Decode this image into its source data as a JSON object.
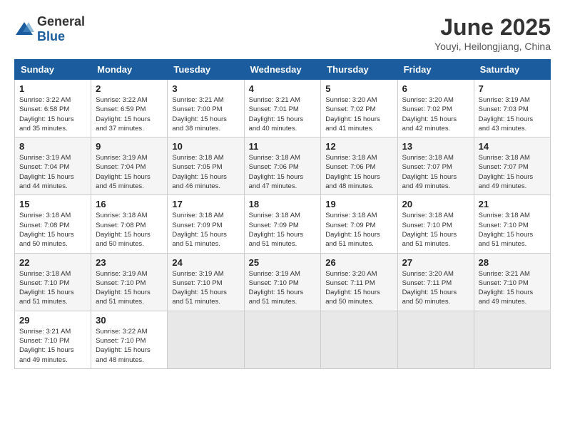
{
  "logo": {
    "general": "General",
    "blue": "Blue"
  },
  "header": {
    "month": "June 2025",
    "location": "Youyi, Heilongjiang, China"
  },
  "weekdays": [
    "Sunday",
    "Monday",
    "Tuesday",
    "Wednesday",
    "Thursday",
    "Friday",
    "Saturday"
  ],
  "weeks": [
    [
      {
        "day": "1",
        "info": "Sunrise: 3:22 AM\nSunset: 6:58 PM\nDaylight: 15 hours\nand 35 minutes."
      },
      {
        "day": "2",
        "info": "Sunrise: 3:22 AM\nSunset: 6:59 PM\nDaylight: 15 hours\nand 37 minutes."
      },
      {
        "day": "3",
        "info": "Sunrise: 3:21 AM\nSunset: 7:00 PM\nDaylight: 15 hours\nand 38 minutes."
      },
      {
        "day": "4",
        "info": "Sunrise: 3:21 AM\nSunset: 7:01 PM\nDaylight: 15 hours\nand 40 minutes."
      },
      {
        "day": "5",
        "info": "Sunrise: 3:20 AM\nSunset: 7:02 PM\nDaylight: 15 hours\nand 41 minutes."
      },
      {
        "day": "6",
        "info": "Sunrise: 3:20 AM\nSunset: 7:02 PM\nDaylight: 15 hours\nand 42 minutes."
      },
      {
        "day": "7",
        "info": "Sunrise: 3:19 AM\nSunset: 7:03 PM\nDaylight: 15 hours\nand 43 minutes."
      }
    ],
    [
      {
        "day": "8",
        "info": "Sunrise: 3:19 AM\nSunset: 7:04 PM\nDaylight: 15 hours\nand 44 minutes."
      },
      {
        "day": "9",
        "info": "Sunrise: 3:19 AM\nSunset: 7:04 PM\nDaylight: 15 hours\nand 45 minutes."
      },
      {
        "day": "10",
        "info": "Sunrise: 3:18 AM\nSunset: 7:05 PM\nDaylight: 15 hours\nand 46 minutes."
      },
      {
        "day": "11",
        "info": "Sunrise: 3:18 AM\nSunset: 7:06 PM\nDaylight: 15 hours\nand 47 minutes."
      },
      {
        "day": "12",
        "info": "Sunrise: 3:18 AM\nSunset: 7:06 PM\nDaylight: 15 hours\nand 48 minutes."
      },
      {
        "day": "13",
        "info": "Sunrise: 3:18 AM\nSunset: 7:07 PM\nDaylight: 15 hours\nand 49 minutes."
      },
      {
        "day": "14",
        "info": "Sunrise: 3:18 AM\nSunset: 7:07 PM\nDaylight: 15 hours\nand 49 minutes."
      }
    ],
    [
      {
        "day": "15",
        "info": "Sunrise: 3:18 AM\nSunset: 7:08 PM\nDaylight: 15 hours\nand 50 minutes."
      },
      {
        "day": "16",
        "info": "Sunrise: 3:18 AM\nSunset: 7:08 PM\nDaylight: 15 hours\nand 50 minutes."
      },
      {
        "day": "17",
        "info": "Sunrise: 3:18 AM\nSunset: 7:09 PM\nDaylight: 15 hours\nand 51 minutes."
      },
      {
        "day": "18",
        "info": "Sunrise: 3:18 AM\nSunset: 7:09 PM\nDaylight: 15 hours\nand 51 minutes."
      },
      {
        "day": "19",
        "info": "Sunrise: 3:18 AM\nSunset: 7:09 PM\nDaylight: 15 hours\nand 51 minutes."
      },
      {
        "day": "20",
        "info": "Sunrise: 3:18 AM\nSunset: 7:10 PM\nDaylight: 15 hours\nand 51 minutes."
      },
      {
        "day": "21",
        "info": "Sunrise: 3:18 AM\nSunset: 7:10 PM\nDaylight: 15 hours\nand 51 minutes."
      }
    ],
    [
      {
        "day": "22",
        "info": "Sunrise: 3:18 AM\nSunset: 7:10 PM\nDaylight: 15 hours\nand 51 minutes."
      },
      {
        "day": "23",
        "info": "Sunrise: 3:19 AM\nSunset: 7:10 PM\nDaylight: 15 hours\nand 51 minutes."
      },
      {
        "day": "24",
        "info": "Sunrise: 3:19 AM\nSunset: 7:10 PM\nDaylight: 15 hours\nand 51 minutes."
      },
      {
        "day": "25",
        "info": "Sunrise: 3:19 AM\nSunset: 7:10 PM\nDaylight: 15 hours\nand 51 minutes."
      },
      {
        "day": "26",
        "info": "Sunrise: 3:20 AM\nSunset: 7:11 PM\nDaylight: 15 hours\nand 50 minutes."
      },
      {
        "day": "27",
        "info": "Sunrise: 3:20 AM\nSunset: 7:11 PM\nDaylight: 15 hours\nand 50 minutes."
      },
      {
        "day": "28",
        "info": "Sunrise: 3:21 AM\nSunset: 7:10 PM\nDaylight: 15 hours\nand 49 minutes."
      }
    ],
    [
      {
        "day": "29",
        "info": "Sunrise: 3:21 AM\nSunset: 7:10 PM\nDaylight: 15 hours\nand 49 minutes."
      },
      {
        "day": "30",
        "info": "Sunrise: 3:22 AM\nSunset: 7:10 PM\nDaylight: 15 hours\nand 48 minutes."
      },
      {
        "day": "",
        "info": ""
      },
      {
        "day": "",
        "info": ""
      },
      {
        "day": "",
        "info": ""
      },
      {
        "day": "",
        "info": ""
      },
      {
        "day": "",
        "info": ""
      }
    ]
  ]
}
